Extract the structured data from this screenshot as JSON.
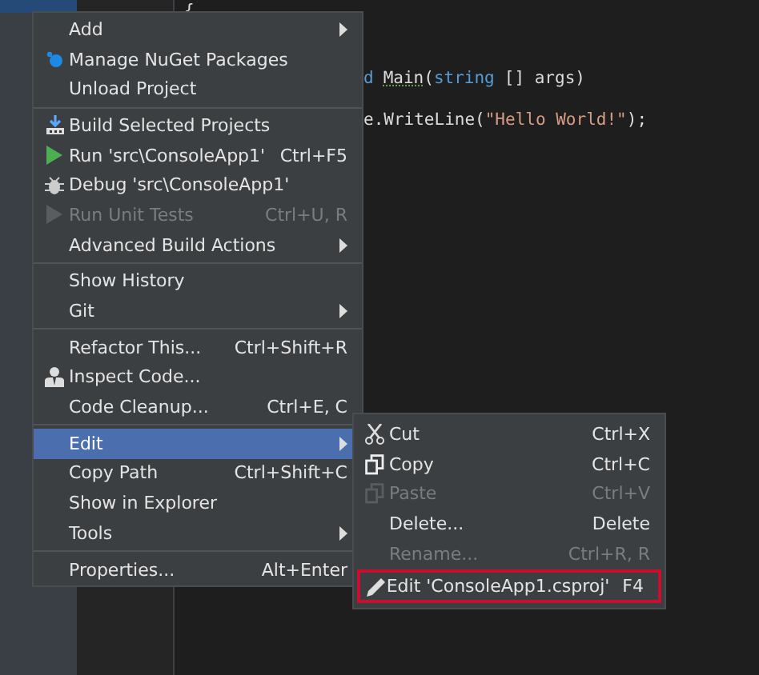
{
  "editor": {
    "lines": [
      [
        {
          "kind": "plain",
          "text": "{"
        }
      ],
      [
        {
          "kind": "keyword",
          "text": "d"
        },
        {
          "kind": "squiggle",
          "text": "Main"
        },
        {
          "kind": "plain",
          "text": "("
        },
        {
          "kind": "keyword",
          "text": "string"
        },
        {
          "kind": "plain",
          "text": "[] args)"
        }
      ],
      [
        {
          "kind": "plain",
          "text": "e.WriteLine("
        },
        {
          "kind": "string",
          "text": "\"Hello World!\""
        },
        {
          "kind": "plain",
          "text": ");"
        }
      ]
    ]
  },
  "context_menu": {
    "items": [
      {
        "kind": "plain",
        "label": "Add",
        "submenu": true,
        "disabled": false,
        "selected": false
      },
      {
        "kind": "nuget",
        "label": "Manage NuGet Packages",
        "disabled": false,
        "selected": false
      },
      {
        "kind": "plain",
        "label": "Unload Project",
        "disabled": false,
        "selected": false
      },
      {
        "kind": "separator"
      },
      {
        "kind": "build",
        "label": "Build Selected Projects",
        "disabled": false,
        "selected": false
      },
      {
        "kind": "run",
        "label": "Run 'src\\ConsoleApp1'",
        "shortcut": "Ctrl+F5",
        "disabled": false,
        "selected": false
      },
      {
        "kind": "debug",
        "label": "Debug 'src\\ConsoleApp1'",
        "disabled": false,
        "selected": false
      },
      {
        "kind": "test",
        "label": "Run Unit Tests",
        "shortcut": "Ctrl+U, R",
        "disabled": true,
        "selected": false
      },
      {
        "kind": "plain",
        "label": "Advanced Build Actions",
        "submenu": true,
        "disabled": false,
        "selected": false
      },
      {
        "kind": "separator"
      },
      {
        "kind": "plain",
        "label": "Show History",
        "disabled": false,
        "selected": false
      },
      {
        "kind": "plain",
        "label": "Git",
        "submenu": true,
        "disabled": false,
        "selected": false
      },
      {
        "kind": "separator"
      },
      {
        "kind": "plain",
        "label": "Refactor This...",
        "shortcut": "Ctrl+Shift+R",
        "disabled": false,
        "selected": false
      },
      {
        "kind": "inspect",
        "label": "Inspect Code...",
        "disabled": false,
        "selected": false
      },
      {
        "kind": "plain",
        "label": "Code Cleanup...",
        "shortcut": "Ctrl+E, C",
        "disabled": false,
        "selected": false
      },
      {
        "kind": "separator"
      },
      {
        "kind": "plain",
        "label": "Edit",
        "submenu": true,
        "disabled": false,
        "selected": true
      },
      {
        "kind": "plain",
        "label": "Copy Path",
        "shortcut": "Ctrl+Shift+C",
        "disabled": false,
        "selected": false
      },
      {
        "kind": "plain",
        "label": "Show in Explorer",
        "disabled": false,
        "selected": false
      },
      {
        "kind": "plain",
        "label": "Tools",
        "submenu": true,
        "disabled": false,
        "selected": false
      },
      {
        "kind": "separator"
      },
      {
        "kind": "plain",
        "label": "Properties...",
        "shortcut": "Alt+Enter",
        "disabled": false,
        "selected": false
      }
    ]
  },
  "edit_submenu": {
    "items": [
      {
        "kind": "cut",
        "label": "Cut",
        "shortcut": "Ctrl+X",
        "disabled": false,
        "outlined": false
      },
      {
        "kind": "copy",
        "label": "Copy",
        "shortcut": "Ctrl+C",
        "disabled": false,
        "outlined": false
      },
      {
        "kind": "paste",
        "label": "Paste",
        "shortcut": "Ctrl+V",
        "disabled": true,
        "outlined": false
      },
      {
        "kind": "plain",
        "label": "Delete...",
        "shortcut": "Delete",
        "disabled": false,
        "outlined": false
      },
      {
        "kind": "plain",
        "label": "Rename...",
        "shortcut": "Ctrl+R, R",
        "disabled": true,
        "outlined": false
      },
      {
        "kind": "edit",
        "label": "Edit 'ConsoleApp1.csproj'",
        "shortcut": "F4",
        "disabled": false,
        "outlined": true
      }
    ]
  }
}
